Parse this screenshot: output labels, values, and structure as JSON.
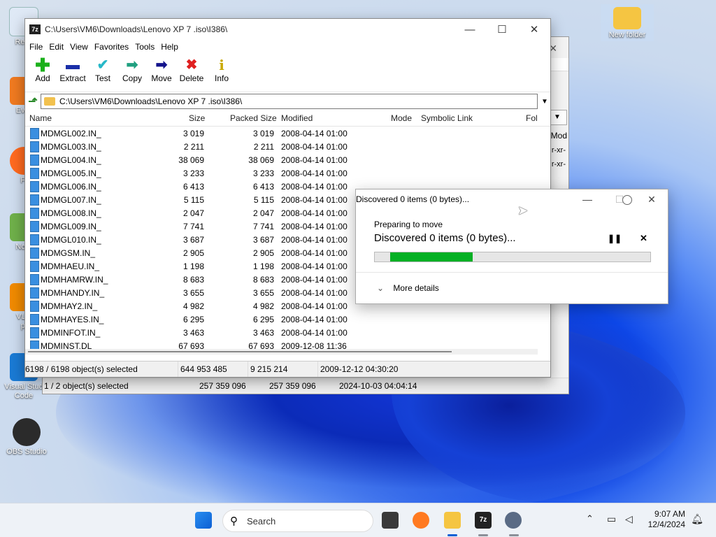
{
  "desktop": {
    "icons": [
      {
        "label": "Recy",
        "key": "recycle"
      },
      {
        "label": "Ever",
        "key": "everything"
      },
      {
        "label": "Fi",
        "key": "firefox"
      },
      {
        "label": "Note",
        "key": "notepad"
      },
      {
        "label": "VLC\npl",
        "key": "vlc"
      },
      {
        "label": "Visual Stud\nCode",
        "key": "vscode"
      },
      {
        "label": "OBS Studio",
        "key": "obs"
      },
      {
        "label": "New folder",
        "key": "newfolder"
      }
    ]
  },
  "back_window": {
    "status_selected": "1 / 2 object(s) selected",
    "status_size": "257 359 096",
    "status_packed": "257 359 096",
    "status_date": "2024-10-03 04:04:14",
    "header_partial": "Mod",
    "perm1": "r-xr-",
    "perm2": "r-xr-"
  },
  "window": {
    "title": "C:\\Users\\VM6\\Downloads\\Lenovo XP 7 .iso\\I386\\",
    "app_icon": "7z",
    "menu": [
      "File",
      "Edit",
      "View",
      "Favorites",
      "Tools",
      "Help"
    ],
    "toolbar": [
      {
        "label": "Add",
        "icon": "add-icon"
      },
      {
        "label": "Extract",
        "icon": "extract-icon"
      },
      {
        "label": "Test",
        "icon": "test-icon"
      },
      {
        "label": "Copy",
        "icon": "copy-icon"
      },
      {
        "label": "Move",
        "icon": "move-icon"
      },
      {
        "label": "Delete",
        "icon": "delete-icon"
      },
      {
        "label": "Info",
        "icon": "info-icon"
      }
    ],
    "address": "C:\\Users\\VM6\\Downloads\\Lenovo XP 7 .iso\\I386\\",
    "columns": [
      "Name",
      "Size",
      "Packed Size",
      "Modified",
      "Mode",
      "Symbolic Link",
      "Fol"
    ],
    "rows": [
      {
        "name": "MDMGL002.IN_",
        "size": "3 019",
        "packed": "3 019",
        "modified": "2008-04-14 01:00"
      },
      {
        "name": "MDMGL003.IN_",
        "size": "2 211",
        "packed": "2 211",
        "modified": "2008-04-14 01:00"
      },
      {
        "name": "MDMGL004.IN_",
        "size": "38 069",
        "packed": "38 069",
        "modified": "2008-04-14 01:00"
      },
      {
        "name": "MDMGL005.IN_",
        "size": "3 233",
        "packed": "3 233",
        "modified": "2008-04-14 01:00"
      },
      {
        "name": "MDMGL006.IN_",
        "size": "6 413",
        "packed": "6 413",
        "modified": "2008-04-14 01:00"
      },
      {
        "name": "MDMGL007.IN_",
        "size": "5 115",
        "packed": "5 115",
        "modified": "2008-04-14 01:00"
      },
      {
        "name": "MDMGL008.IN_",
        "size": "2 047",
        "packed": "2 047",
        "modified": "2008-04-14 01:00"
      },
      {
        "name": "MDMGL009.IN_",
        "size": "7 741",
        "packed": "7 741",
        "modified": "2008-04-14 01:00"
      },
      {
        "name": "MDMGL010.IN_",
        "size": "3 687",
        "packed": "3 687",
        "modified": "2008-04-14 01:00"
      },
      {
        "name": "MDMGSM.IN_",
        "size": "2 905",
        "packed": "2 905",
        "modified": "2008-04-14 01:00"
      },
      {
        "name": "MDMHAEU.IN_",
        "size": "1 198",
        "packed": "1 198",
        "modified": "2008-04-14 01:00"
      },
      {
        "name": "MDMHAMRW.IN_",
        "size": "8 683",
        "packed": "8 683",
        "modified": "2008-04-14 01:00"
      },
      {
        "name": "MDMHANDY.IN_",
        "size": "3 655",
        "packed": "3 655",
        "modified": "2008-04-14 01:00"
      },
      {
        "name": "MDMHAY2.IN_",
        "size": "4 982",
        "packed": "4 982",
        "modified": "2008-04-14 01:00"
      },
      {
        "name": "MDMHAYES.IN_",
        "size": "6 295",
        "packed": "6 295",
        "modified": "2008-04-14 01:00"
      },
      {
        "name": "MDMINFOT.IN_",
        "size": "3 463",
        "packed": "3 463",
        "modified": "2008-04-14 01:00"
      },
      {
        "name": "MDMINST.DL_",
        "size": "67 693",
        "packed": "67 693",
        "modified": "2009-12-08 11:36"
      }
    ],
    "status": {
      "selected": "6198 / 6198 object(s) selected",
      "size": "644 953 485",
      "packed": "9 215 214",
      "date": "2009-12-12 04:30:20"
    }
  },
  "dialog": {
    "title": "Discovered 0 items (0 bytes)...",
    "subtitle": "Preparing to move",
    "headline": "Discovered 0 items (0 bytes)...",
    "progress": 0.3,
    "more_details": "More details"
  },
  "taskbar": {
    "search_placeholder": "Search",
    "time": "9:07 AM",
    "date": "12/4/2024"
  }
}
